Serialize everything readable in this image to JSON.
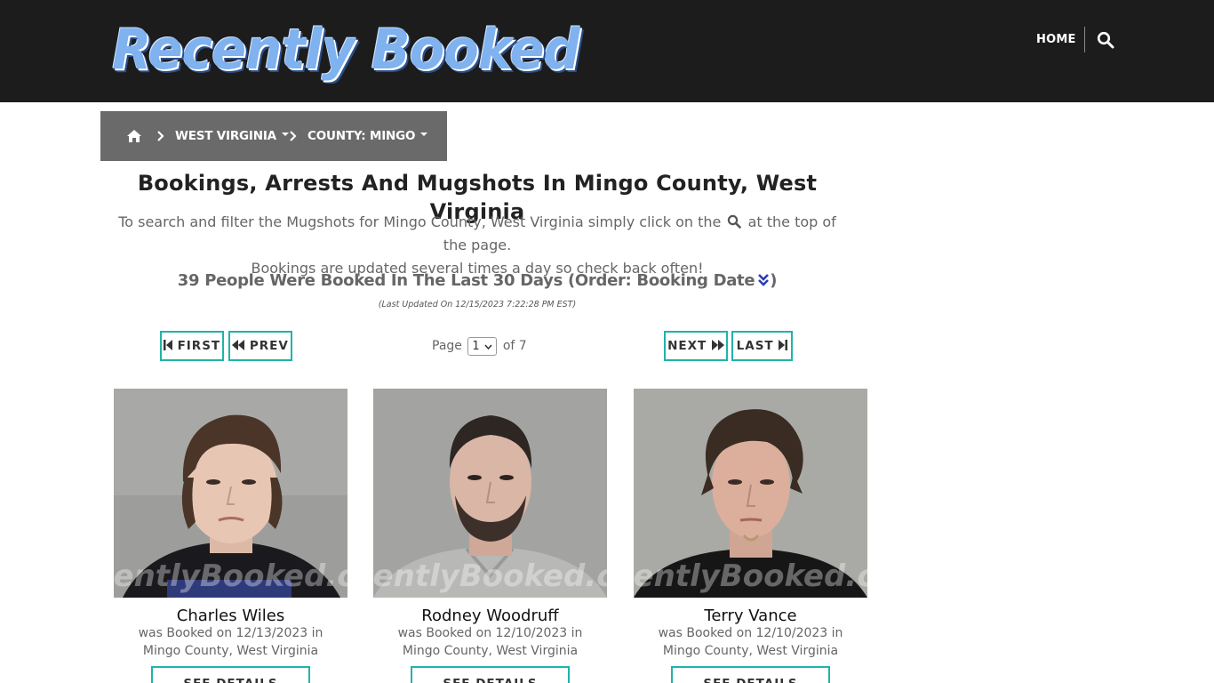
{
  "header": {
    "logo_text": "Recently Booked",
    "nav_home": "HOME"
  },
  "breadcrumb": {
    "state": "WEST VIRGINIA",
    "county": "COUNTY: MINGO"
  },
  "page": {
    "title": "Bookings, Arrests And Mugshots In Mingo County, West Virginia",
    "intro_before_icon": "To search and filter the Mugshots for Mingo County, West Virginia simply click on the",
    "intro_after_icon": "at the top of the page.",
    "intro_line2": "Bookings are updated several times a day so check back often!",
    "count_text": "39 People Were Booked In The Last 30 Days (Order: Booking Date",
    "count_close": ")",
    "last_updated": "(Last Updated On 12/15/2023 7:22:28 PM EST)"
  },
  "pagination": {
    "first": "FIRST",
    "prev": "PREV",
    "next": "NEXT",
    "last": "LAST",
    "page_label": "Page",
    "current_page": "1",
    "of_label": "of 7"
  },
  "watermark": "RecentlyBooked.com",
  "people": [
    {
      "name": "Charles Wiles",
      "booked_line1": "was Booked on 12/13/2023 in",
      "booked_line2": "Mingo County, West Virginia",
      "button": "SEE DETAILS"
    },
    {
      "name": "Rodney Woodruff",
      "booked_line1": "was Booked on 12/10/2023 in",
      "booked_line2": "Mingo County, West Virginia",
      "button": "SEE DETAILS"
    },
    {
      "name": "Terry Vance",
      "booked_line1": "was Booked on 12/10/2023 in",
      "booked_line2": "Mingo County, West Virginia",
      "button": "SEE DETAILS"
    }
  ],
  "colors": {
    "header_bg": "#1c1c1c",
    "breadcrumb_bg": "#6a6a6a",
    "accent_teal": "#1fb4a8",
    "order_icon": "#2a3db8"
  },
  "icons": {
    "search": "search-icon",
    "home": "home-icon",
    "chevron": "chevron-right-icon",
    "order": "double-chevron-down-icon",
    "first": "step-backward-icon",
    "prev": "fast-backward-icon",
    "next": "fast-forward-icon",
    "last": "step-forward-icon"
  }
}
